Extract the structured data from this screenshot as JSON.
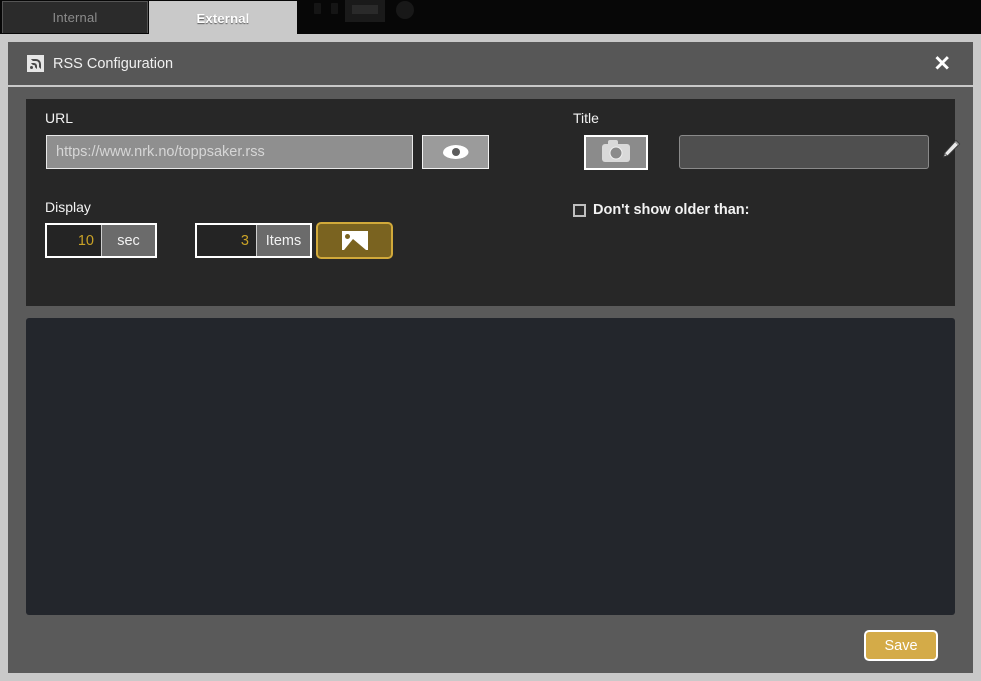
{
  "tabs": [
    {
      "label": "Internal",
      "active": false
    },
    {
      "label": "External",
      "active": true
    }
  ],
  "toolbar": {
    "icons": [
      "columns-icon",
      "monitor-icon",
      "globe-icon"
    ]
  },
  "dialog": {
    "icon": "rss-icon",
    "title": "RSS Configuration",
    "close_label": "✕"
  },
  "form": {
    "url": {
      "label": "URL",
      "value": "",
      "placeholder": "https://www.nrk.no/toppsaker.rss",
      "preview_icon": "eye-icon"
    },
    "title": {
      "label": "Title",
      "value": "",
      "placeholder": "",
      "camera_icon": "camera-icon",
      "edit_icon": "pencil-icon"
    },
    "display": {
      "label": "Display",
      "duration_value": "10",
      "duration_unit": "sec",
      "items_value": "3",
      "items_unit": "Items",
      "image_toggle_icon": "image-icon"
    },
    "older_than": {
      "label": "Don't show older than:",
      "checked": false
    }
  },
  "footer": {
    "save_label": "Save"
  },
  "colors": {
    "accent_gold": "#d4ab48",
    "number_gold": "#c9a227",
    "toggle_gold_fill": "#7a6320",
    "toggle_gold_border": "#d1a93a",
    "dialog_body": "#5a5a5a",
    "panel_dark": "#272727",
    "preview_dark": "#23262c",
    "frame_light": "#c9c9c9"
  }
}
